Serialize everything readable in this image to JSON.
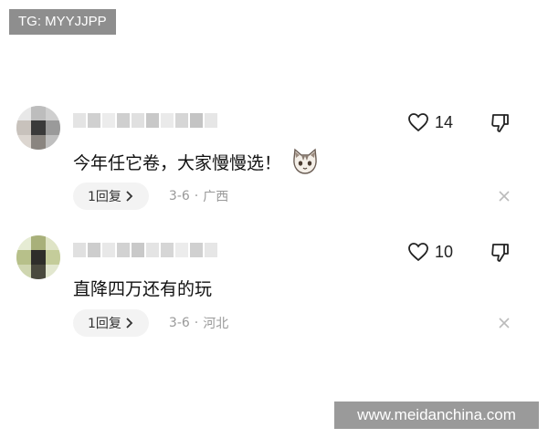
{
  "watermark_top": "TG: MYYJJPP",
  "watermark_bottom": "www.meidanchina.com",
  "comments": [
    {
      "like_count": "14",
      "text": "今年任它卷，大家慢慢选！",
      "emoji_icon": "cat-face-icon",
      "reply_label": "1回复",
      "date": "3-6",
      "separator": "·",
      "location": "广西"
    },
    {
      "like_count": "10",
      "text": "直降四万还有的玩",
      "reply_label": "1回复",
      "date": "3-6",
      "separator": "·",
      "location": "河北"
    }
  ],
  "colors": {
    "text": "#111111",
    "meta": "#999999",
    "pill_bg": "#f3f3f3",
    "watermark_bg": "#8e8e8e"
  }
}
